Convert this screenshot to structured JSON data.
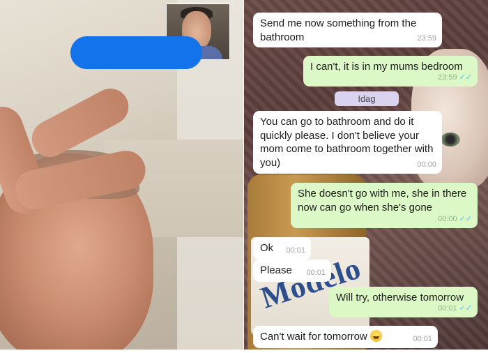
{
  "messages": [
    {
      "id": "m1",
      "dir": "in",
      "text": "Send me now something from the bathroom",
      "time": "23:59",
      "read": false
    },
    {
      "id": "m2",
      "dir": "out",
      "text": "I can't, it is in my mums bedroom",
      "time": "23:59",
      "read": true
    },
    {
      "id": "m3",
      "dir": "in",
      "text": "You can go to bathroom and do it quickly please. I don't believe your mom come to bathroom together with you)",
      "time": "00:00",
      "read": false
    },
    {
      "id": "m4",
      "dir": "out",
      "text": "She doesn't go with me, she in there now can go when she's gone",
      "time": "00:00",
      "read": true
    },
    {
      "id": "m5",
      "dir": "in",
      "text": "Ok",
      "time": "00:01",
      "read": false
    },
    {
      "id": "m6",
      "dir": "in",
      "text": "Please",
      "time": "00:01",
      "read": false
    },
    {
      "id": "m7",
      "dir": "out",
      "text": "Will try, otherwise tomorrow",
      "time": "00:01",
      "read": true
    },
    {
      "id": "m8",
      "dir": "in",
      "text": "Can't wait for tomorrow",
      "time": "00:01",
      "read": false,
      "emoji": "grinning-sweat-emoji"
    }
  ],
  "date_separator": "Idag",
  "background_label_text": "Modelo",
  "colors": {
    "incoming_bubble": "#ffffff",
    "outgoing_bubble": "#dcf8c6",
    "read_ticks": "#4fc3f7",
    "redaction": "#1273ea",
    "date_chip": "#d9d3f0"
  },
  "icons": {
    "read_receipt": "double-check-icon"
  }
}
